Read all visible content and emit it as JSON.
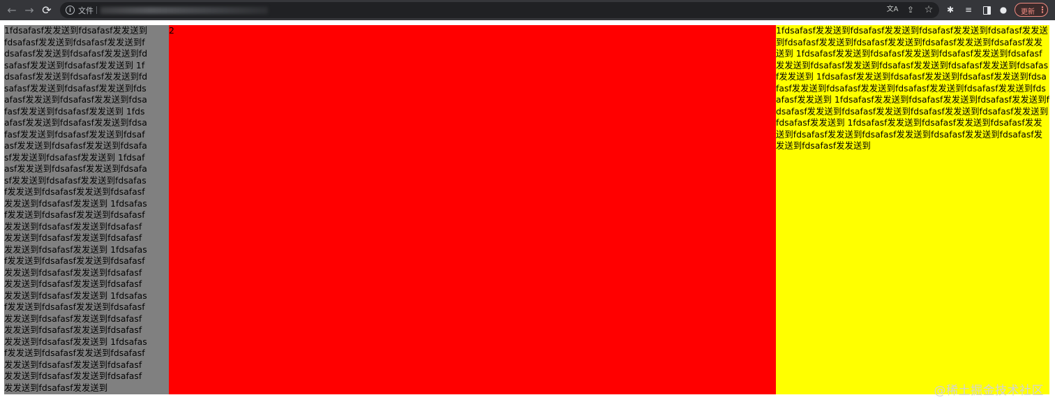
{
  "browser": {
    "scheme_label": "文件",
    "update_label": "更新",
    "icons": {
      "back": "←",
      "forward": "→",
      "reload": "⟳",
      "info": "i",
      "translate": "文A",
      "share": "⇪",
      "bookmark": "☆",
      "extensions": "✱",
      "media": "≡",
      "profile": "●",
      "menu": "⋮"
    }
  },
  "page": {
    "left_text": "1fdsafasf发发送到fdsafasf发发送到fdsafasf发发送到fdsafasf发发送到fdsafasf发发送到fdsafasf发发送到fdsafasf发发送到fdsafasf发发送到 1fdsafasf发发送到fdsafasf发发送到fdsafasf发发送到fdsafasf发发送到fdsafasf发发送到fdsafasf发发送到fdsafasf发发送到fdsafasf发发送到 1fdsafasf发发送到fdsafasf发发送到fdsafasf发发送到fdsafasf发发送到fdsafasf发发送到fdsafasf发发送到fdsafasf发发送到fdsafasf发发送到 1fdsafasf发发送到fdsafasf发发送到fdsafasf发发送到fdsafasf发发送到fdsafasf发发送到fdsafasf发发送到fdsafasf发发送到fdsafasf发发送到 1fdsafasf发发送到fdsafasf发发送到fdsafasf发发送到fdsafasf发发送到fdsafasf发发送到fdsafasf发发送到fdsafasf发发送到fdsafasf发发送到 1fdsafasf发发送到fdsafasf发发送到fdsafasf发发送到fdsafasf发发送到fdsafasf发发送到fdsafasf发发送到fdsafasf发发送到fdsafasf发发送到 1fdsafasf发发送到fdsafasf发发送到fdsafasf发发送到fdsafasf发发送到fdsafasf发发送到fdsafasf发发送到fdsafasf发发送到fdsafasf发发送到 1fdsafasf发发送到fdsafasf发发送到fdsafasf发发送到fdsafasf发发送到fdsafasf发发送到fdsafasf发发送到fdsafasf发发送到fdsafasf发发送到",
    "middle_text": "2",
    "right_text": "1fdsafasf发发送到fdsafasf发发送到fdsafasf发发送到fdsafasf发发送到fdsafasf发发送到fdsafasf发发送到fdsafasf发发送到fdsafasf发发送到 1fdsafasf发发送到fdsafasf发发送到fdsafasf发发送到fdsafasf发发送到fdsafasf发发送到fdsafasf发发送到fdsafasf发发送到fdsafasf发发送到 1fdsafasf发发送到fdsafasf发发送到fdsafasf发发送到fdsafasf发发送到fdsafasf发发送到fdsafasf发发送到fdsafasf发发送到fdsafasf发发送到 1fdsafasf发发送到fdsafasf发发送到fdsafasf发发送到fdsafasf发发送到fdsafasf发发送到fdsafasf发发送到fdsafasf发发送到fdsafasf发发送到 1fdsafasf发发送到fdsafasf发发送到fdsafasf发发送到fdsafasf发发送到fdsafasf发发送到fdsafasf发发送到fdsafasf发发送到fdsafasf发发送到",
    "colors": {
      "left": "#808080",
      "middle": "#ff0000",
      "right": "#ffff00"
    }
  },
  "watermark": "@稀土掘金技术社区"
}
